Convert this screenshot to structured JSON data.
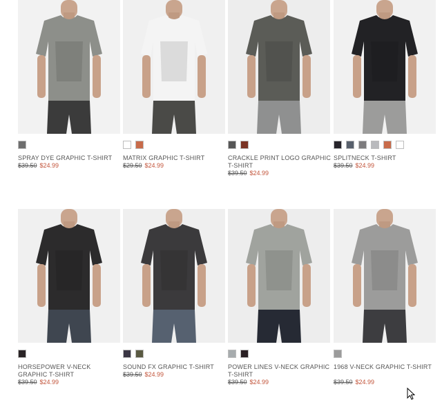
{
  "products": [
    {
      "name": "SPRAY DYE GRAPHIC T-SHIRT",
      "old_price": "$39.50",
      "sale_price": "$24.99",
      "swatches": [
        "#6e6e6e"
      ],
      "shirt": "#8d8f8a",
      "bg": "#f2f2f2",
      "pants": "#3b3b3b"
    },
    {
      "name": "MATRIX GRAPHIC T-SHIRT",
      "old_price": "$29.50",
      "sale_price": "$24.99",
      "swatches": [
        "#ffffff",
        "#c86b4a"
      ],
      "shirt": "#f4f4f4",
      "bg": "#f0f0f0",
      "pants": "#4a4a47"
    },
    {
      "name": "CRACKLE PRINT LOGO GRAPHIC T-SHIRT",
      "old_price": "$39.50",
      "sale_price": "$24.99",
      "swatches": [
        "#565656",
        "#7a3324"
      ],
      "shirt": "#5b5c57",
      "bg": "#ededed",
      "pants": "#8f9090"
    },
    {
      "name": "SPLITNECK T-SHIRT",
      "old_price": "$39.50",
      "sale_price": "$24.99",
      "swatches": [
        "#26242b",
        "#58606c",
        "#7d7c7e",
        "#b9babd",
        "#c86b4a",
        "#ffffff"
      ],
      "shirt": "#222225",
      "bg": "#f1f1f1",
      "pants": "#9c9c9b"
    },
    {
      "name": "HORSEPOWER V-NECK GRAPHIC T-SHIRT",
      "old_price": "$39.50",
      "sale_price": "$24.99",
      "swatches": [
        "#2a2426"
      ],
      "shirt": "#2c2b2c",
      "bg": "#f0f0f0",
      "pants": "#3f4650"
    },
    {
      "name": "SOUND FX GRAPHIC T-SHIRT",
      "old_price": "$39.50",
      "sale_price": "$24.99",
      "swatches": [
        "#3a3644",
        "#5a5a42"
      ],
      "shirt": "#3b3a3c",
      "bg": "#efefef",
      "pants": "#566170"
    },
    {
      "name": "POWER LINES V-NECK GRAPHIC T-SHIRT",
      "old_price": "$39.50",
      "sale_price": "$24.99",
      "swatches": [
        "#a7acae",
        "#2a2024"
      ],
      "shirt": "#a0a39e",
      "bg": "#ededed",
      "pants": "#262a34"
    },
    {
      "name": "1968 V-NECK GRAPHIC T-SHIRT",
      "old_price": "$39.50",
      "sale_price": "$24.99",
      "swatches": [
        "#9b9b9b"
      ],
      "shirt": "#9c9c9b",
      "bg": "#f0f0f0",
      "pants": "#3d3d40"
    }
  ]
}
